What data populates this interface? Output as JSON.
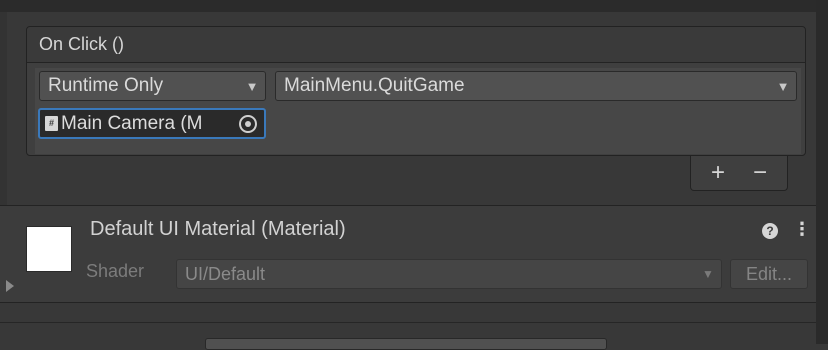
{
  "event": {
    "title": "On Click ()",
    "runtime_mode": "Runtime Only",
    "function": "MainMenu.QuitGame",
    "target_object": "Main Camera (M",
    "add_label": "+",
    "remove_label": "−"
  },
  "material": {
    "title": "Default UI Material (Material)",
    "shader_label": "Shader",
    "shader_value": "UI/Default",
    "edit_label": "Edit...",
    "swatch_color": "#ffffff"
  },
  "icons": {
    "dropdown_arrow": "▼",
    "help": "?",
    "menu": "⋮"
  }
}
